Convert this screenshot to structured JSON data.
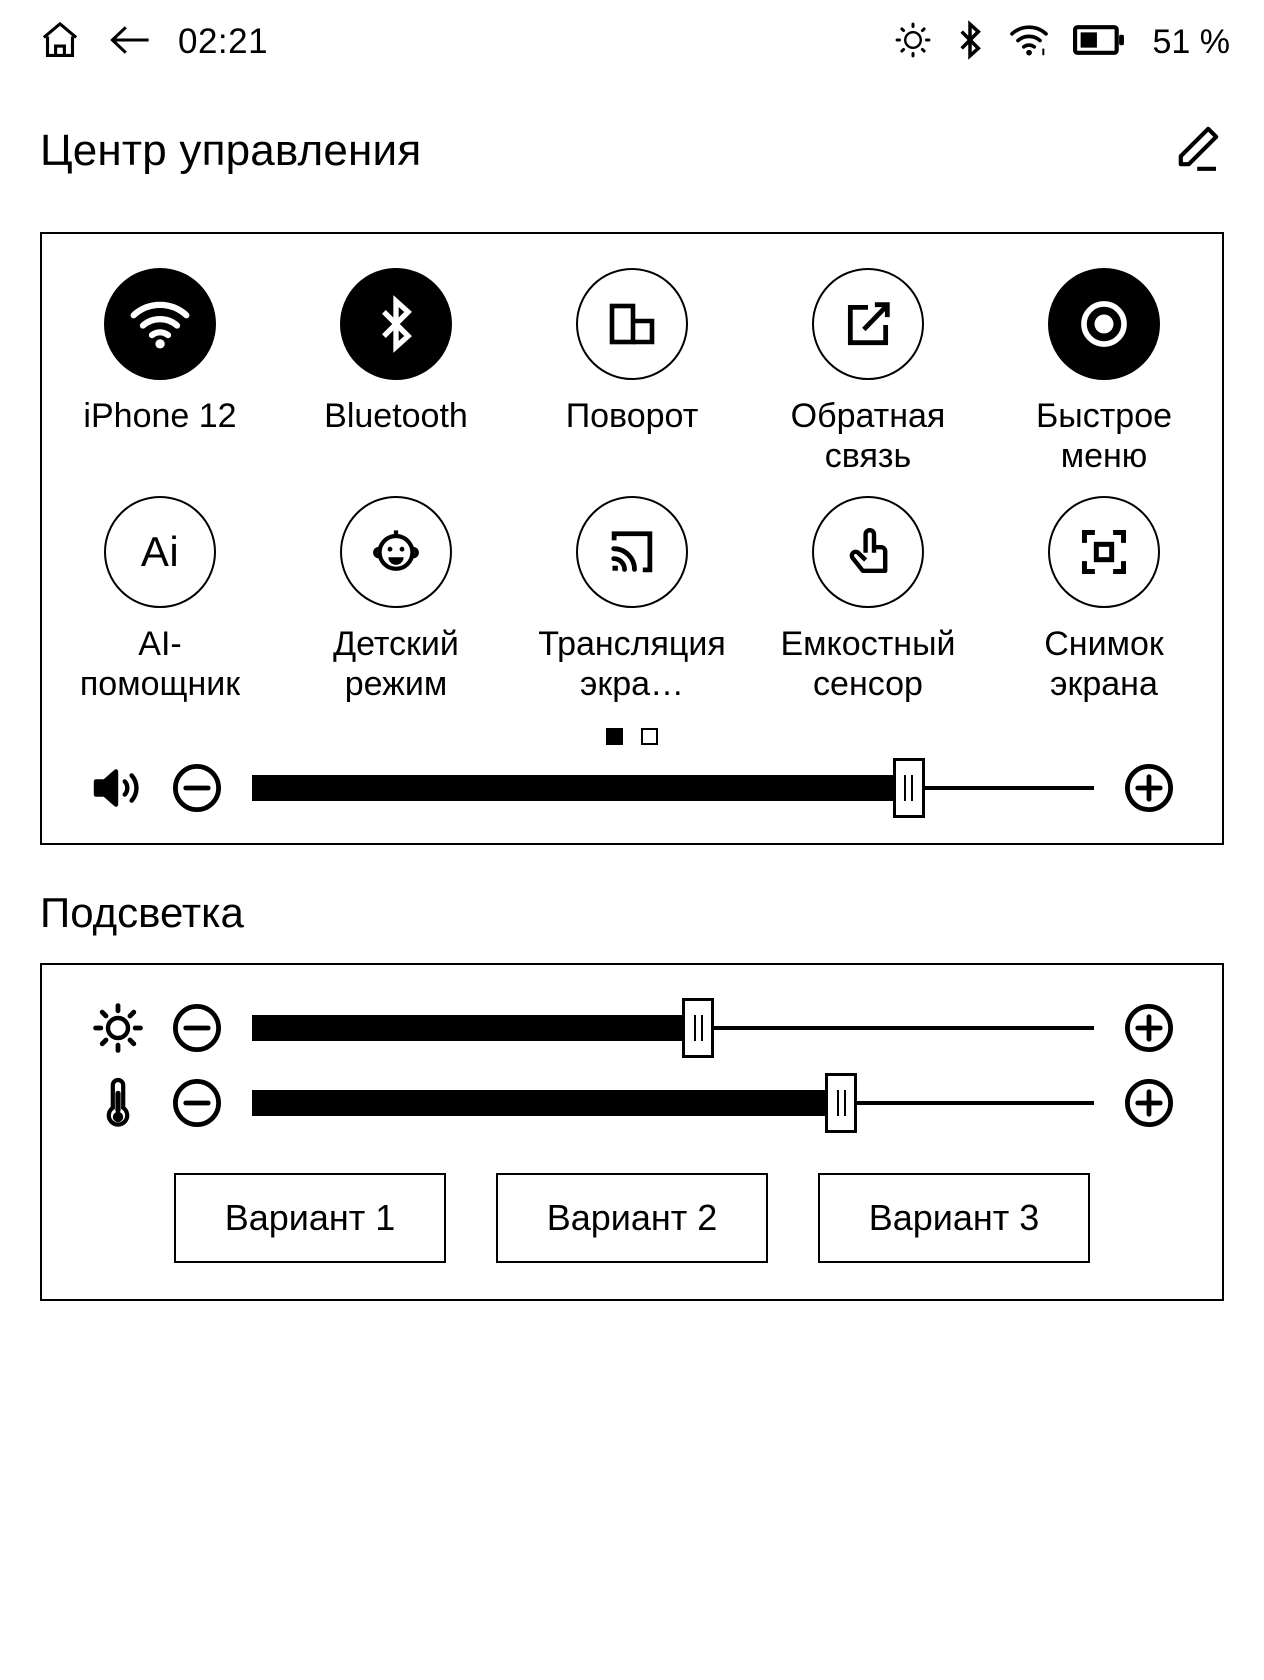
{
  "status_bar": {
    "home_icon": "home-icon",
    "back_icon": "back-arrow-icon",
    "time": "02:21",
    "brightness_icon": "brightness-icon",
    "bluetooth_icon": "bluetooth-icon",
    "wifi_icon": "wifi-icon",
    "battery_icon": "battery-icon",
    "battery_text": "51 %"
  },
  "header": {
    "title": "Центр управления",
    "edit_icon": "pencil-edit-icon"
  },
  "quick_settings": {
    "tiles": [
      {
        "label": "iPhone 12",
        "icon": "wifi-icon",
        "active": true
      },
      {
        "label": "Bluetooth",
        "icon": "bluetooth-icon",
        "active": true
      },
      {
        "label": "Поворот",
        "icon": "rotation-icon",
        "active": false
      },
      {
        "label": "Обратная связь",
        "icon": "feedback-icon",
        "active": false
      },
      {
        "label": "Быстрое меню",
        "icon": "quick-menu-icon",
        "active": true
      },
      {
        "label": "AI-помощник",
        "icon": "ai-assistant-icon",
        "active": false
      },
      {
        "label": "Детский режим",
        "icon": "child-mode-icon",
        "active": false
      },
      {
        "label": "Трансляция экра…",
        "icon": "screencast-icon",
        "active": false
      },
      {
        "label": "Емкостный сенсор",
        "icon": "touch-hand-icon",
        "active": false
      },
      {
        "label": "Снимок экрана",
        "icon": "screenshot-icon",
        "active": false
      }
    ],
    "ai_icon_text": "Ai",
    "pages": {
      "count": 2,
      "current": 1
    },
    "volume": {
      "icon": "speaker-volume-icon",
      "minus_icon": "minus-circle-icon",
      "plus_icon": "plus-circle-icon",
      "value": 78
    }
  },
  "backlight": {
    "heading": "Подсветка",
    "brightness": {
      "icon": "brightness-sun-icon",
      "minus_icon": "minus-circle-icon",
      "plus_icon": "plus-circle-icon",
      "value": 53
    },
    "warmth": {
      "icon": "thermometer-icon",
      "minus_icon": "minus-circle-icon",
      "plus_icon": "plus-circle-icon",
      "value": 70
    },
    "variants": [
      {
        "label": "Вариант 1"
      },
      {
        "label": "Вариант 2"
      },
      {
        "label": "Вариант 3"
      }
    ]
  },
  "colors": {
    "ink": "#000000",
    "paper": "#ffffff"
  }
}
